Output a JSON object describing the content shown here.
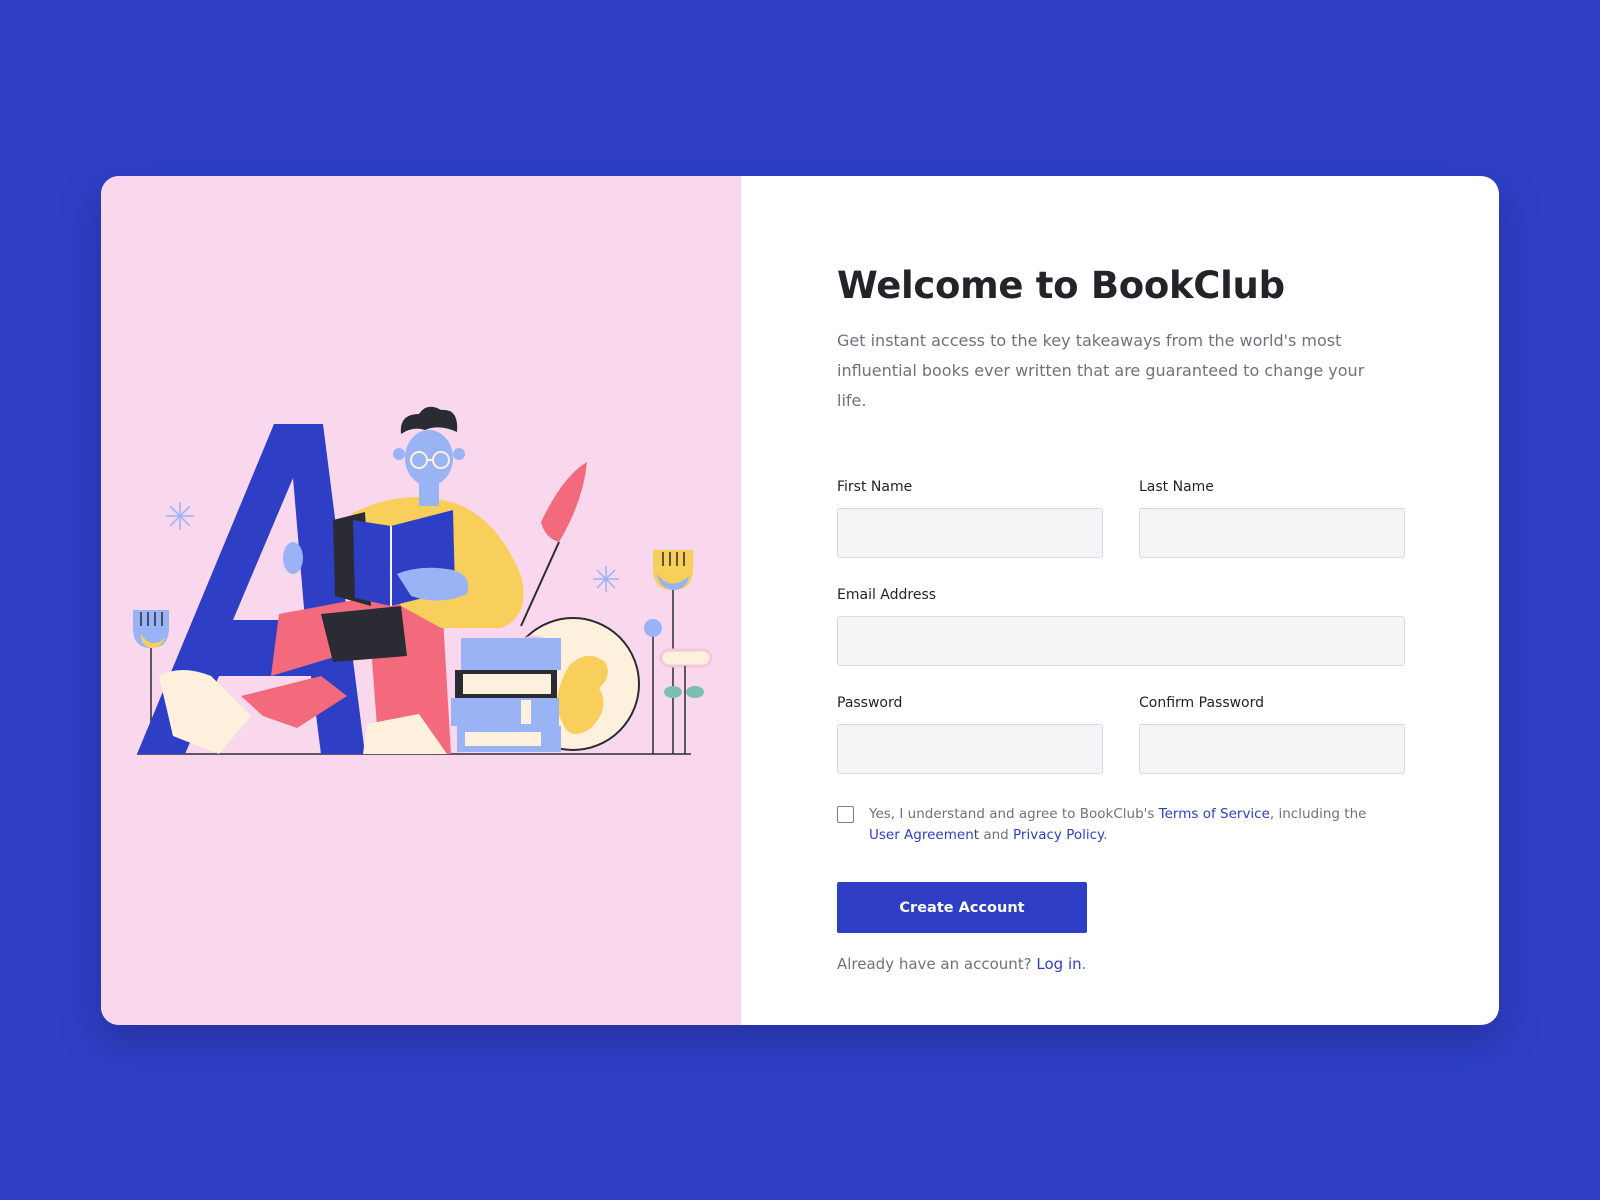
{
  "colors": {
    "page_background": "#2f3fc5",
    "card_background": "#ffffff",
    "illustration_background": "#f9d8ee",
    "accent": "#2f3fc5",
    "heading_text": "#23242a",
    "muted_text": "#6f727c",
    "input_background": "#f4f5f7"
  },
  "illustration": {
    "icon": "reading-person-with-letter-a-illustration"
  },
  "signup": {
    "title": "Welcome to BookClub",
    "subtitle": "Get instant access to the key takeaways from the world's most influential books ever written that are guaranteed to change your life.",
    "fields": {
      "first_name": {
        "label": "First Name",
        "value": "",
        "placeholder": ""
      },
      "last_name": {
        "label": "Last Name",
        "value": "",
        "placeholder": ""
      },
      "email": {
        "label": "Email Address",
        "value": "",
        "placeholder": ""
      },
      "password": {
        "label": "Password",
        "value": "",
        "placeholder": ""
      },
      "confirm_password": {
        "label": "Confirm Password",
        "value": "",
        "placeholder": ""
      }
    },
    "consent": {
      "checked": false,
      "text_before": "Yes, I understand and agree to BookClub's ",
      "terms_link": "Terms of Service",
      "text_middle": ", including the ",
      "user_agreement_link": "User Agreement",
      "text_and": " and ",
      "privacy_link": "Privacy Policy",
      "text_end": "."
    },
    "submit_label": "Create Account",
    "login_prompt": "Already have an account? ",
    "login_link": "Log in",
    "login_end": "."
  }
}
